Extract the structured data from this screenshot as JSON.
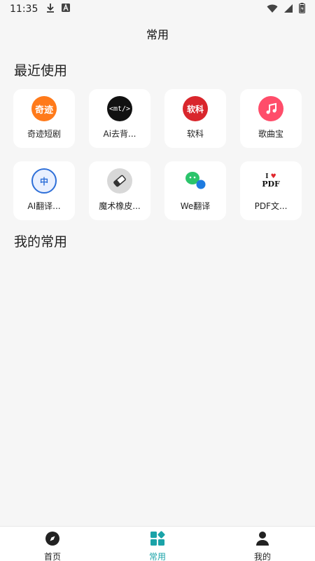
{
  "status_bar": {
    "time": "11:35",
    "left_icons": [
      "download-icon",
      "a-box-icon"
    ],
    "right_icons": [
      "wifi-icon",
      "signal-icon",
      "battery-icon"
    ]
  },
  "header": {
    "title": "常用"
  },
  "recent": {
    "title": "最近使用",
    "apps": [
      {
        "label": "奇迹短剧",
        "icon": "qiji-icon",
        "icon_text": "奇迹",
        "color": "#ff7a1a"
      },
      {
        "label": "Ai去背...",
        "icon": "mt-icon",
        "icon_text": "<mt/>",
        "color": "#111111"
      },
      {
        "label": "软科",
        "icon": "ruanke-icon",
        "icon_text": "软科",
        "color": "#d9262c"
      },
      {
        "label": "歌曲宝",
        "icon": "music-note-icon",
        "icon_text": "♫",
        "color": "#ff4d6a"
      },
      {
        "label": "AI翻译...",
        "icon": "ai-translate-icon",
        "icon_text": "中",
        "color": "#2e6fd8"
      },
      {
        "label": "魔术橡皮...",
        "icon": "eraser-icon",
        "icon_text": "",
        "color": "#d8d8d8"
      },
      {
        "label": "We翻译",
        "icon": "we-translate-icon",
        "icon_text": "",
        "color": "#2bc46b"
      },
      {
        "label": "PDF文...",
        "icon": "pdf-icon",
        "icon_text": "PDF",
        "color": "#ffffff"
      }
    ]
  },
  "favorites": {
    "title": "我的常用"
  },
  "bottom_nav": {
    "items": [
      {
        "label": "首页",
        "icon": "compass-icon",
        "active": false
      },
      {
        "label": "常用",
        "icon": "apps-icon",
        "active": true
      },
      {
        "label": "我的",
        "icon": "person-icon",
        "active": false
      }
    ]
  },
  "colors": {
    "accent": "#1aa3a8",
    "background": "#f6f6f6"
  }
}
